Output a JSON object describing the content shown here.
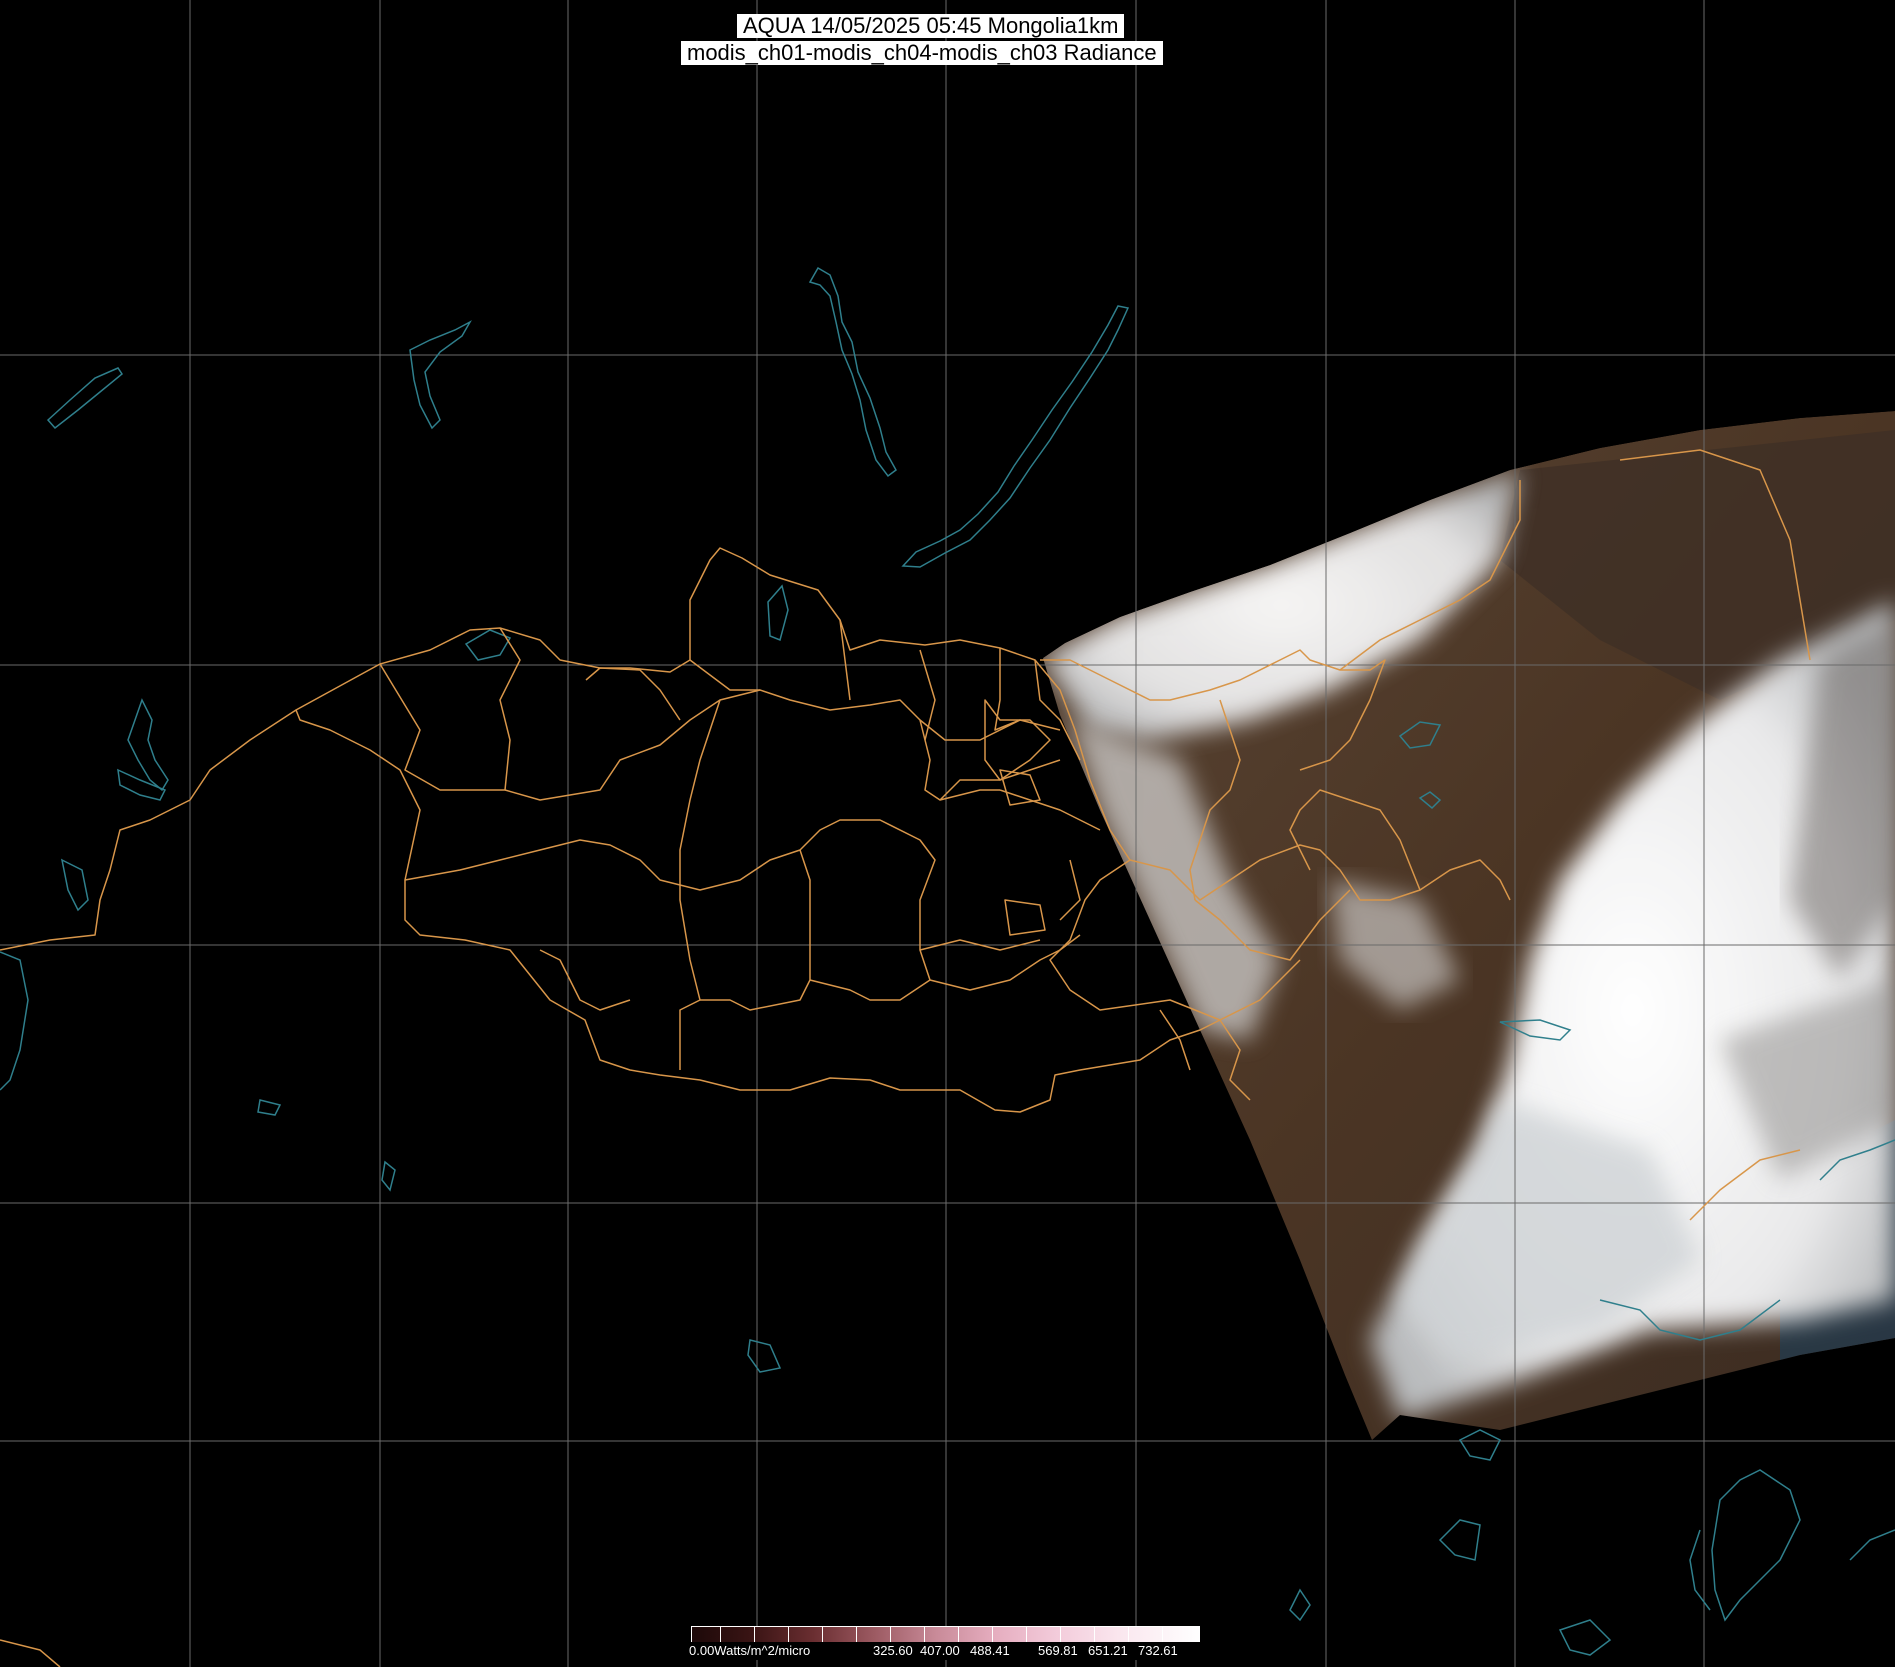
{
  "title": {
    "line1": "AQUA 14/05/2025 05:45 Mongolia1km",
    "line2": "modis_ch01-modis_ch04-modis_ch03 Radiance"
  },
  "colorbar": {
    "unit_label": "0.00Watts/m^2/micro",
    "tick_labels": [
      "325.60",
      "407.00",
      "488.41",
      "569.81",
      "651.21",
      "732.61"
    ]
  },
  "colors": {
    "background": "#000000",
    "graticule": "#6a6a6a",
    "admin_boundaries": "#d8964a",
    "coastlines_lakes": "#2f7f8c",
    "land": "#4a3526",
    "cloud": "#f2f2f2"
  }
}
